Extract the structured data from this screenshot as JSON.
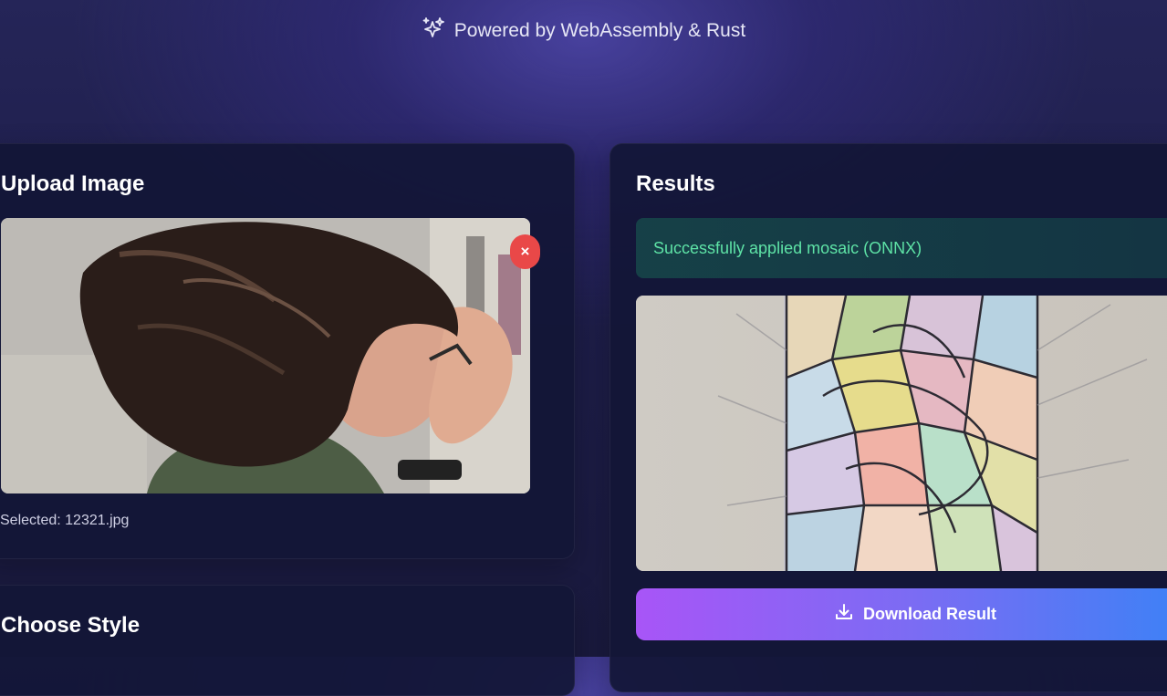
{
  "header": {
    "tagline": "Powered by WebAssembly & Rust",
    "tagline_icon": "sparkles-icon"
  },
  "upload": {
    "title": "Upload Image",
    "remove_label": "×",
    "selected_text": "Selected: 12321.jpg"
  },
  "style": {
    "title": "Choose Style"
  },
  "results": {
    "title": "Results",
    "status_message": "Successfully applied mosaic (ONNX)",
    "download_label": "Download Result",
    "download_icon": "download-icon"
  },
  "colors": {
    "success_text": "#5ee3a6",
    "remove_button": "#e94848",
    "button_gradient_start": "#a855f7",
    "button_gradient_end": "#3b82f6"
  }
}
